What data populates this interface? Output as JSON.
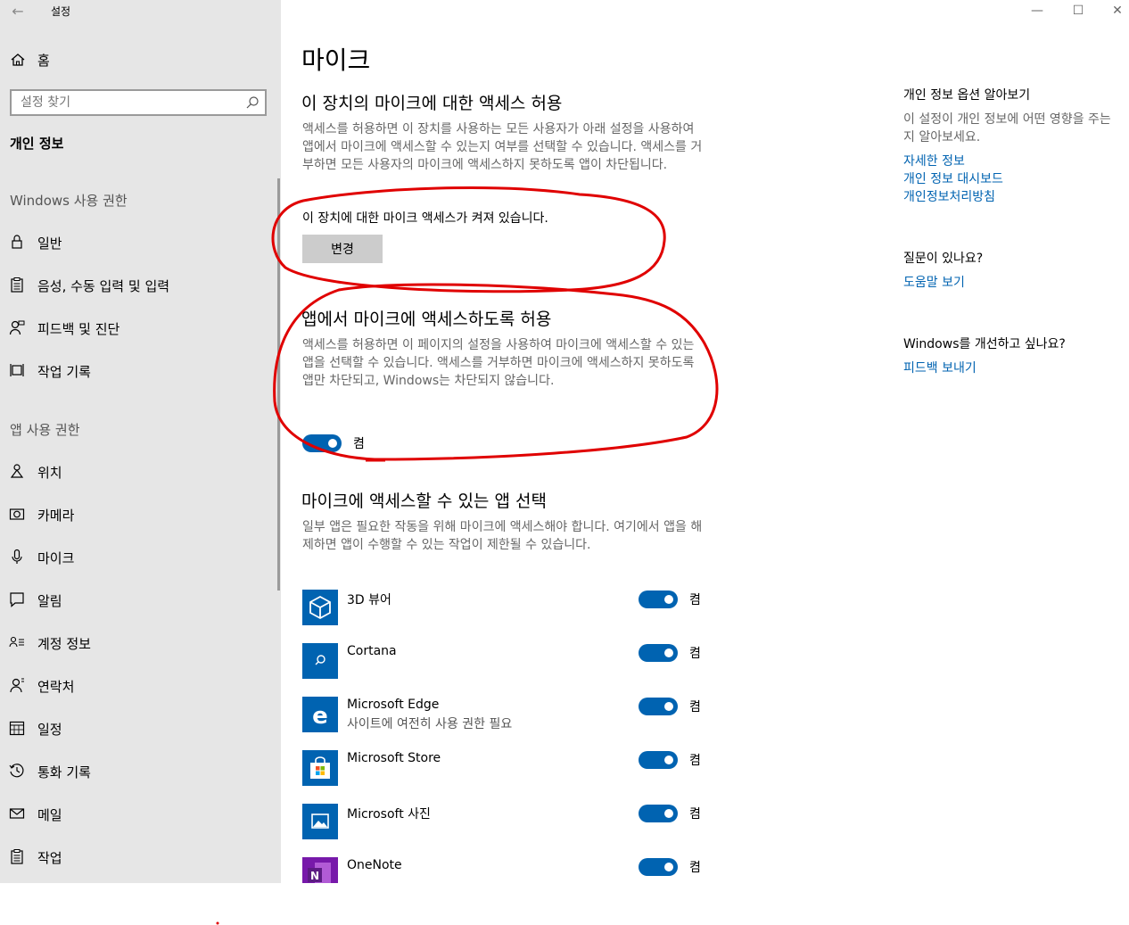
{
  "window": {
    "title": "설정",
    "back_icon": "arrow-left-icon",
    "controls": {
      "minimize": "—",
      "maximize": "☐",
      "close": "✕"
    }
  },
  "sidebar": {
    "home_label": "홈",
    "search_placeholder": "설정 찾기",
    "current_section": "개인 정보",
    "group1_label": "Windows 사용 권한",
    "group1_items": [
      {
        "label": "일반",
        "icon": "lock-icon"
      },
      {
        "label": "음성, 수동 입력 및 입력",
        "icon": "clipboard-icon"
      },
      {
        "label": "피드백 및 진단",
        "icon": "person-feedback-icon"
      },
      {
        "label": "작업 기록",
        "icon": "timeline-icon"
      }
    ],
    "group2_label": "앱 사용 권한",
    "group2_items": [
      {
        "label": "위치",
        "icon": "location-icon"
      },
      {
        "label": "카메라",
        "icon": "camera-icon"
      },
      {
        "label": "마이크",
        "icon": "microphone-icon"
      },
      {
        "label": "알림",
        "icon": "notification-icon"
      },
      {
        "label": "계정 정보",
        "icon": "account-info-icon"
      },
      {
        "label": "연락처",
        "icon": "contacts-icon"
      },
      {
        "label": "일정",
        "icon": "calendar-icon"
      },
      {
        "label": "통화 기록",
        "icon": "call-history-icon"
      },
      {
        "label": "메일",
        "icon": "mail-icon"
      },
      {
        "label": "작업",
        "icon": "tasks-icon"
      }
    ]
  },
  "main": {
    "title": "마이크",
    "device_section": {
      "heading": "이 장치의 마이크에 대한 액세스 허용",
      "description": "액세스를 허용하면 이 장치를 사용하는 모든 사용자가 아래 설정을 사용하여 앱에서 마이크에 액세스할 수 있는지 여부를 선택할 수 있습니다. 액세스를 거부하면 모든 사용자의 마이크에 액세스하지 못하도록 앱이 차단됩니다.",
      "status": "이 장치에 대한 마이크 액세스가 켜져 있습니다.",
      "change_button": "변경"
    },
    "apps_section": {
      "heading": "앱에서 마이크에 액세스하도록 허용",
      "description": "액세스를 허용하면 이 페이지의 설정을 사용하여 마이크에 액세스할 수 있는 앱을 선택할 수 있습니다. 액세스를 거부하면 마이크에 액세스하지 못하도록 앱만 차단되고, Windows는 차단되지 않습니다.",
      "toggle_label": "켬",
      "toggle_on": true
    },
    "choose_section": {
      "heading": "마이크에 액세스할 수 있는 앱 선택",
      "description": "일부 앱은 필요한 작동을 위해 마이크에 액세스해야 합니다. 여기에서 앱을 해제하면 앱이 수행할 수 있는 작업이 제한될 수 있습니다.",
      "apps": [
        {
          "name": "3D 뷰어",
          "sub": "",
          "toggle": "켬",
          "icon": "3d-viewer-icon",
          "color": "#0063b1"
        },
        {
          "name": "Cortana",
          "sub": "",
          "toggle": "켬",
          "icon": "cortana-icon",
          "color": "#0063b1"
        },
        {
          "name": "Microsoft Edge",
          "sub": "사이트에 여전히 사용 권한 필요",
          "toggle": "켬",
          "icon": "edge-icon",
          "color": "#0063b1"
        },
        {
          "name": "Microsoft Store",
          "sub": "",
          "toggle": "켬",
          "icon": "store-icon",
          "color": "#0063b1"
        },
        {
          "name": "Microsoft 사진",
          "sub": "",
          "toggle": "켬",
          "icon": "photos-icon",
          "color": "#0063b1"
        },
        {
          "name": "OneNote",
          "sub": "",
          "toggle": "켬",
          "icon": "onenote-icon",
          "color": "#7719aa"
        }
      ]
    }
  },
  "right_panel": {
    "privacy_heading": "개인 정보 옵션 알아보기",
    "privacy_text": "이 설정이 개인 정보에 어떤 영향을 주는지 알아보세요.",
    "links": [
      "자세한 정보",
      "개인 정보 대시보드",
      "개인정보처리방침"
    ],
    "question_heading": "질문이 있나요?",
    "help_link": "도움말 보기",
    "improve_heading": "Windows를 개선하고 싶나요?",
    "feedback_link": "피드백 보내기"
  },
  "colors": {
    "accent": "#0063b1",
    "sidebar_bg": "#e6e6e6",
    "annotation": "#e00000"
  }
}
